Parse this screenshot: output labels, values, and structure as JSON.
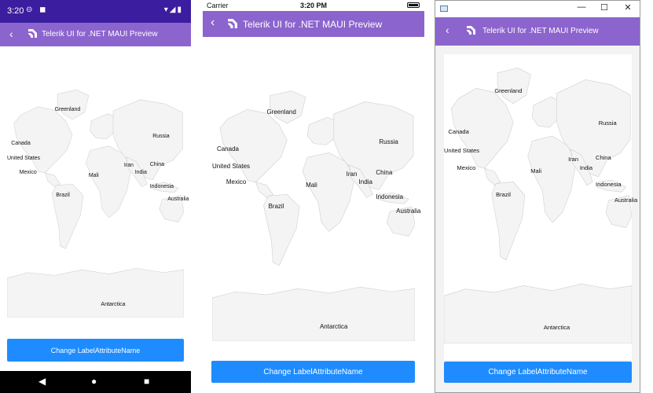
{
  "android": {
    "status_time": "3:20",
    "status_icons": "⊝ ◼",
    "status_right": "▾◢▮",
    "title": "Telerik UI for .NET MAUI Preview",
    "back_glyph": "‹",
    "button_label": "Change LabelAttributeName",
    "nav_back": "◀",
    "nav_home": "●",
    "nav_recent": "■"
  },
  "ios": {
    "carrier": "Carrier",
    "status_time": "3:20 PM",
    "title": "Telerik UI for .NET MAUI Preview",
    "back_glyph": "‹",
    "button_label": "Change LabelAttributeName"
  },
  "windows": {
    "minimize": "—",
    "maximize": "☐",
    "close": "✕",
    "title": "Telerik UI for .NET MAUI Preview",
    "back_glyph": "‹",
    "button_label": "Change LabelAttributeName"
  },
  "map_labels": {
    "greenland": "Greenland",
    "canada": "Canada",
    "united_states": "United States",
    "mexico": "Mexico",
    "brazil": "Brazil",
    "mali": "Mali",
    "iran": "Iran",
    "india": "India",
    "china": "China",
    "russia": "Russia",
    "indonesia": "Indonesia",
    "australia": "Australia",
    "antarctica": "Antarctica"
  },
  "colors": {
    "accent_purple": "#8c64cd",
    "android_statusbar": "#3b1d9f",
    "button_blue": "#1e8cff",
    "map_land": "#f4f4f4",
    "map_border": "#cfcfcf"
  },
  "icons": {
    "logo": "telerik-logo-icon",
    "back": "back-arrow-icon"
  }
}
